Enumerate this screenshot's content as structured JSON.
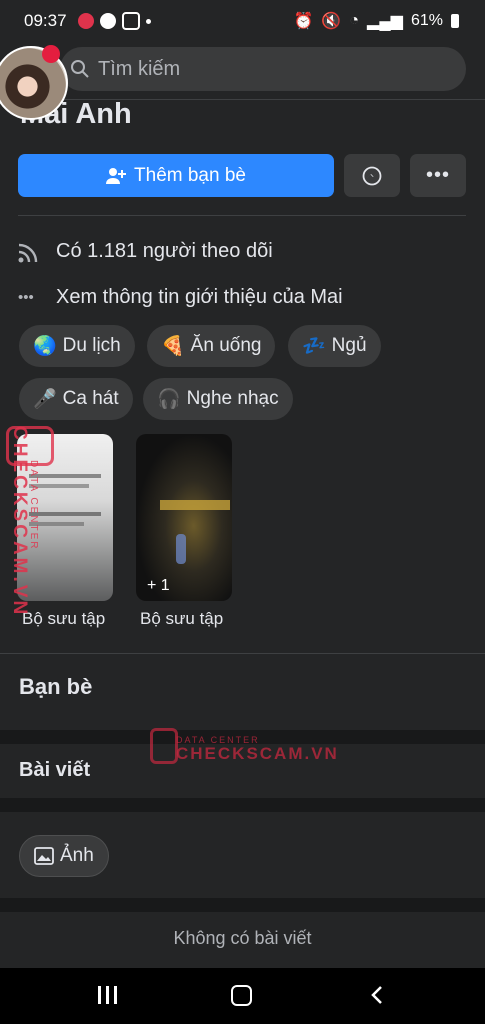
{
  "status": {
    "time": "09:37",
    "battery": "61%"
  },
  "search": {
    "placeholder": "Tìm kiếm"
  },
  "profile": {
    "name": "Mai Anh"
  },
  "actions": {
    "add_friend": "Thêm bạn bè"
  },
  "details": {
    "followers": "Có 1.181 người theo dõi",
    "about": "Xem thông tin giới thiệu của Mai"
  },
  "hobbies": [
    {
      "emoji": "🌏",
      "label": "Du lịch"
    },
    {
      "emoji": "🍕",
      "label": "Ăn uống"
    },
    {
      "emoji": "💤",
      "label": "Ngủ"
    },
    {
      "emoji": "🎤",
      "label": "Ca hát"
    },
    {
      "emoji": "🎧",
      "label": "Nghe nhạc"
    }
  ],
  "collections": [
    {
      "label": "Bộ sưu tập",
      "count": ""
    },
    {
      "label": "Bộ sưu tập",
      "count": "+ 1"
    }
  ],
  "sections": {
    "friends": "Bạn bè",
    "posts": "Bài viết",
    "photos_chip": "Ảnh",
    "empty": "Không có bài viết"
  },
  "watermark": {
    "brand": "CHECKSCAM.VN",
    "sub": "DATA CENTER"
  },
  "colors": {
    "accent": "#2d88ff",
    "bg": "#242526",
    "chip": "#3a3b3c"
  }
}
